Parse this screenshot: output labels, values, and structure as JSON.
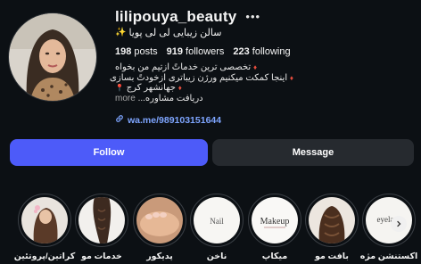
{
  "profile": {
    "username": "lilipouya_beauty",
    "more_icon": "ellipsis-icon",
    "full_name": "سالن زیبایی لی لی پویا",
    "sparkle_icon": "sparkles-emoji",
    "stats": {
      "posts_count": "198",
      "posts_label": "posts",
      "followers_count": "919",
      "followers_label": "followers",
      "following_count": "223",
      "following_label": "following"
    },
    "bio": {
      "line1": "تخصصی ترین خدماتً ازتیم من بخواه",
      "line2": "اینجا کمکت میکنیم ورژن زیباتری ازخودتً بسازی",
      "line3": "جهانشهر کرج",
      "line4": "دریافت مشاوره...",
      "more_label": "more"
    },
    "link": {
      "icon": "link-icon",
      "text": "wa.me/989103151644"
    }
  },
  "actions": {
    "follow_label": "Follow",
    "message_label": "Message"
  },
  "highlights": [
    {
      "label": "کراتین/پروتئین",
      "icon": "hair-treatment"
    },
    {
      "label": "خدمات مو",
      "icon": "hair-braid"
    },
    {
      "label": "پدیکور",
      "icon": "pedicure"
    },
    {
      "label": "ناخن",
      "icon": "nails"
    },
    {
      "label": "میکاپ",
      "icon": "makeup"
    },
    {
      "label": "بافت مو",
      "icon": "hair-weave"
    },
    {
      "label": "اکستنشن مژه",
      "icon": "eyelash"
    }
  ],
  "highlight_texts": {
    "nails": "Nail",
    "makeup": "Makeup",
    "eyelash": "eyelash"
  },
  "colors": {
    "background": "#0c1014",
    "follow_button": "#4d5bf9",
    "message_button": "#262a2f",
    "link": "#7ea5ff"
  }
}
